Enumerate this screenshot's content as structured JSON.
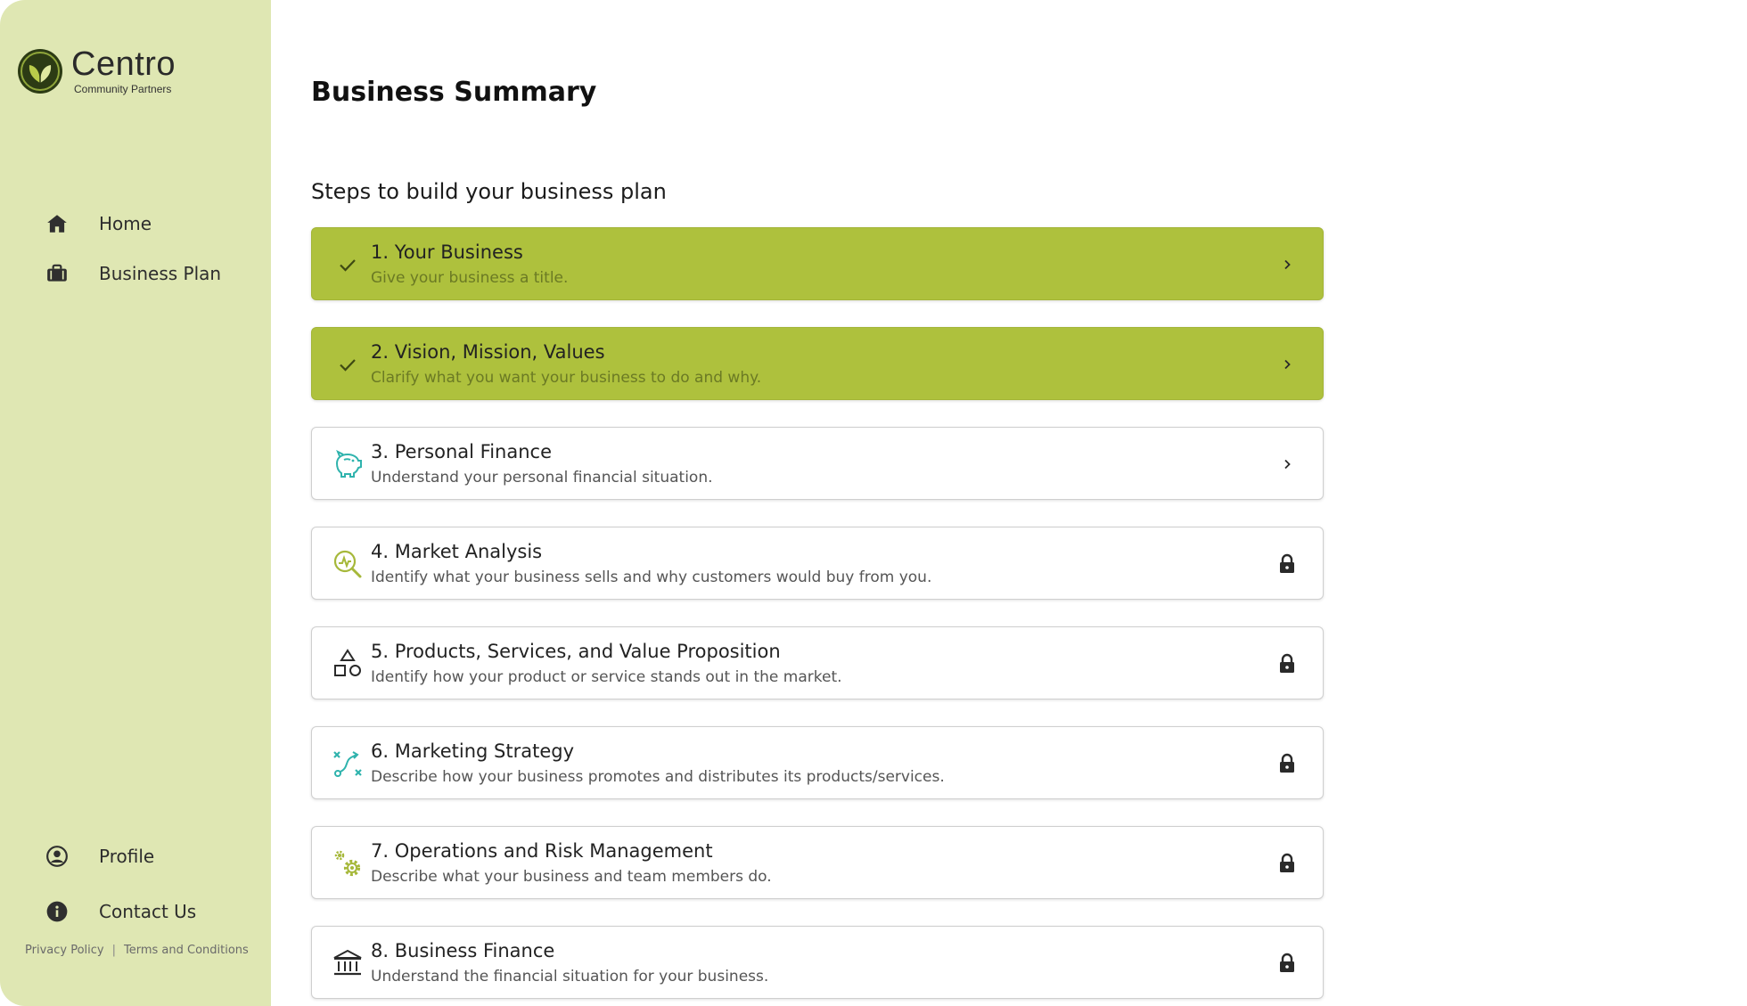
{
  "brand": {
    "name": "Centro",
    "tagline": "Community Partners",
    "color": "#2c3b14"
  },
  "sidebar": {
    "nav": [
      {
        "label": "Home",
        "icon": "home-icon"
      },
      {
        "label": "Business Plan",
        "icon": "briefcase-icon"
      }
    ],
    "bottom": [
      {
        "label": "Profile",
        "icon": "user-circle-icon"
      },
      {
        "label": "Contact Us",
        "icon": "info-icon"
      }
    ],
    "links": {
      "privacy": "Privacy Policy",
      "sep": "|",
      "terms": "Terms and Conditions"
    },
    "background": "#dfe7b3"
  },
  "main": {
    "title": "Business Summary",
    "section_title": "Steps to build your business plan",
    "steps": [
      {
        "title": "1. Your Business",
        "desc": "Give your business a title.",
        "status": "complete",
        "icon": "check-icon",
        "trail": "chevron-right-icon"
      },
      {
        "title": "2. Vision, Mission, Values",
        "desc": "Clarify what you want your business to do and why.",
        "status": "complete",
        "icon": "check-icon",
        "trail": "chevron-right-icon"
      },
      {
        "title": "3. Personal Finance",
        "desc": "Understand your personal financial situation.",
        "status": "available",
        "icon": "piggy-bank-icon",
        "trail": "chevron-right-icon"
      },
      {
        "title": "4. Market Analysis",
        "desc": "Identify what your business sells and why customers would buy from you.",
        "status": "locked",
        "icon": "market-analysis-icon",
        "trail": "lock-icon"
      },
      {
        "title": "5. Products, Services, and Value Proposition",
        "desc": "Identify how your product or service stands out in the market.",
        "status": "locked",
        "icon": "shapes-icon",
        "trail": "lock-icon"
      },
      {
        "title": "6. Marketing Strategy",
        "desc": "Describe how your business promotes and distributes its products/services.",
        "status": "locked",
        "icon": "strategy-path-icon",
        "trail": "lock-icon"
      },
      {
        "title": "7. Operations and Risk Management",
        "desc": "Describe what your business and team members do.",
        "status": "locked",
        "icon": "gears-icon",
        "trail": "lock-icon"
      },
      {
        "title": "8. Business Finance",
        "desc": "Understand the financial situation for your business.",
        "status": "locked",
        "icon": "bank-icon",
        "trail": "lock-icon"
      }
    ]
  },
  "colors": {
    "complete": "#aec13d",
    "accent_teal": "#2fb3ad",
    "accent_olive": "#a6b83a"
  }
}
